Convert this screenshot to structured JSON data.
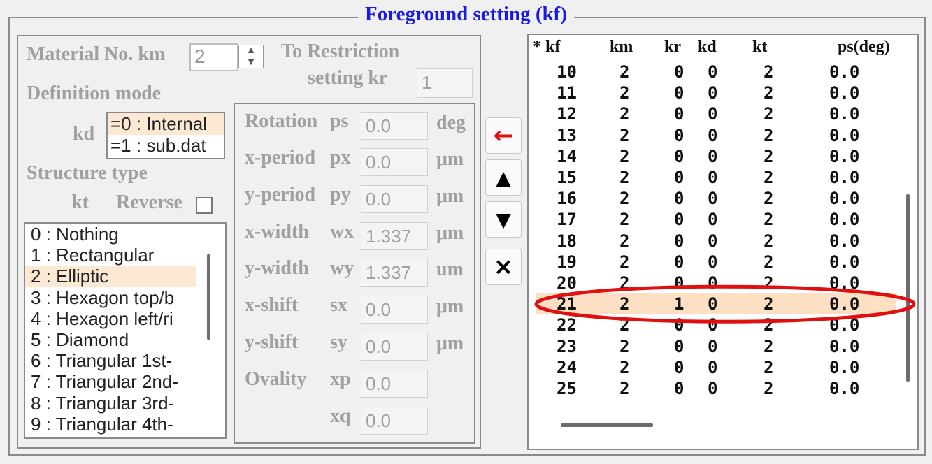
{
  "title": "Foreground setting (kf)",
  "material": {
    "label": "Material No.  km",
    "value": "2"
  },
  "restriction": {
    "label1": "To Restriction",
    "label2": "setting  kr",
    "value": "1"
  },
  "definition_mode": {
    "label": "Definition mode",
    "kd_label": "kd",
    "options": [
      "=0 : Internal",
      "=1 : sub.dat"
    ],
    "selected": "=0 : Internal"
  },
  "structure": {
    "label": "Structure type",
    "kt_label": "kt",
    "reverse_label": "Reverse",
    "reverse_checked": false,
    "items": [
      "0 : Nothing",
      "1 : Rectangular",
      "2 : Elliptic",
      "3 : Hexagon top/b",
      "4 : Hexagon left/ri",
      "5 : Diamond",
      "6 : Triangular 1st-",
      "7 : Triangular 2nd-",
      "8 : Triangular 3rd-",
      "9 : Triangular 4th-"
    ],
    "selected": "2 : Elliptic"
  },
  "params": [
    {
      "label": "Rotation",
      "sym": "ps",
      "value": "0.0",
      "unit": "deg"
    },
    {
      "label": "x-period",
      "sym": "px",
      "value": "0.0",
      "unit": "μm"
    },
    {
      "label": "y-period",
      "sym": "py",
      "value": "0.0",
      "unit": "μm"
    },
    {
      "label": "x-width",
      "sym": "wx",
      "value": "1.337",
      "unit": "μm"
    },
    {
      "label": "y-width",
      "sym": "wy",
      "value": "1.337",
      "unit": "um"
    },
    {
      "label": "x-shift",
      "sym": "sx",
      "value": "0.0",
      "unit": "μm"
    },
    {
      "label": "y-shift",
      "sym": "sy",
      "value": "0.0",
      "unit": "μm"
    },
    {
      "label": "Ovality",
      "sym": "xp",
      "value": "0.0",
      "unit": ""
    },
    {
      "label": "",
      "sym": "xq",
      "value": "0.0",
      "unit": ""
    }
  ],
  "buttons": {
    "apply": "←",
    "up": "▲",
    "down": "▼",
    "delete": "×"
  },
  "table": {
    "headers": [
      "* kf",
      "km",
      "kr",
      "kd",
      "kt",
      "ps(deg)"
    ],
    "rows": [
      [
        "10",
        "2",
        "0",
        "0",
        "2",
        "0.0"
      ],
      [
        "11",
        "2",
        "0",
        "0",
        "2",
        "0.0"
      ],
      [
        "12",
        "2",
        "0",
        "0",
        "2",
        "0.0"
      ],
      [
        "13",
        "2",
        "0",
        "0",
        "2",
        "0.0"
      ],
      [
        "14",
        "2",
        "0",
        "0",
        "2",
        "0.0"
      ],
      [
        "15",
        "2",
        "0",
        "0",
        "2",
        "0.0"
      ],
      [
        "16",
        "2",
        "0",
        "0",
        "2",
        "0.0"
      ],
      [
        "17",
        "2",
        "0",
        "0",
        "2",
        "0.0"
      ],
      [
        "18",
        "2",
        "0",
        "0",
        "2",
        "0.0"
      ],
      [
        "19",
        "2",
        "0",
        "0",
        "2",
        "0.0"
      ],
      [
        "20",
        "2",
        "0",
        "0",
        "2",
        "0.0"
      ],
      [
        "21",
        "2",
        "1",
        "0",
        "2",
        "0.0"
      ],
      [
        "22",
        "2",
        "0",
        "0",
        "2",
        "0.0"
      ],
      [
        "23",
        "2",
        "0",
        "0",
        "2",
        "0.0"
      ],
      [
        "24",
        "2",
        "0",
        "0",
        "2",
        "0.0"
      ],
      [
        "25",
        "2",
        "0",
        "0",
        "2",
        "0.0"
      ]
    ],
    "selected_row": "21"
  },
  "colors": {
    "title": "#1a1ae0",
    "selection": "#fde0c4",
    "highlight_ellipse": "#e01010",
    "apply_arrow": "#e01010"
  }
}
